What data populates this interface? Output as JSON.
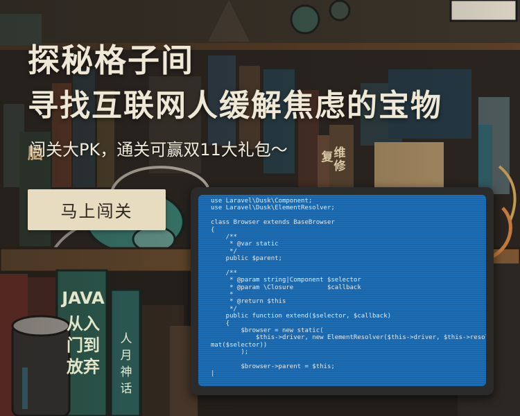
{
  "headline": {
    "line1": "探秘格子间",
    "line2": "寻找互联网人缓解焦虑的宝物"
  },
  "subtitle": "闯关大PK，通关可赢双11大礼包～",
  "cta_label": "马上闯关",
  "books": {
    "java_title": "JAVA",
    "java_cn": "从入门到放弃",
    "myth": "人月神话",
    "top_left": "脑",
    "top_right_a": "复",
    "top_right_b": "维修"
  },
  "code_lines": [
    "use Laravel\\Dusk\\Component;",
    "use Laravel\\Dusk\\ElementResolver;",
    "",
    "class Browser extends BaseBrowser",
    "{",
    "    /**",
    "     * @var static",
    "     */",
    "    public $parent;",
    "",
    "    /**",
    "     * @param string|Component $selector",
    "     * @param \\Closure         $callback",
    "     *",
    "     * @return $this",
    "     */",
    "    public function extend($selector, $callback)",
    "    {",
    "        $browser = new static(",
    "            $this->driver, new ElementResolver($this->driver, $this->resolver->for-",
    "mat($selector))",
    "        );",
    "",
    "        $browser->parent = $this;",
    "|"
  ],
  "colors": {
    "screen": "#1d6db4",
    "button_bg": "#e7dbc0",
    "headline_text": "#efe8d6"
  }
}
